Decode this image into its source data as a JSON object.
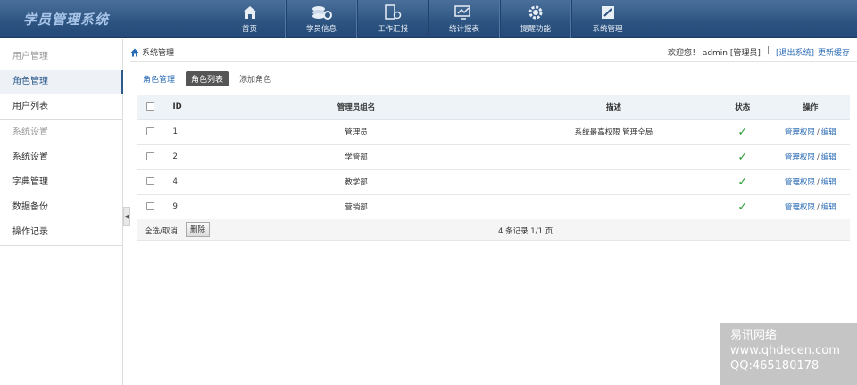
{
  "app": {
    "title": "学员管理系统"
  },
  "nav": [
    {
      "label": "首页",
      "icon": "home-icon"
    },
    {
      "label": "学员信息",
      "icon": "users-icon"
    },
    {
      "label": "工作汇报",
      "icon": "report-icon"
    },
    {
      "label": "统计报表",
      "icon": "chart-icon"
    },
    {
      "label": "提醒功能",
      "icon": "gear-icon"
    },
    {
      "label": "系统管理",
      "icon": "edit-icon"
    }
  ],
  "sidebar": {
    "group1": "用户管理",
    "items1": [
      "角色管理",
      "用户列表"
    ],
    "group2": "系统设置",
    "items2": [
      "系统设置",
      "字典管理",
      "数据备份",
      "操作记录"
    ]
  },
  "breadcrumb": {
    "label": "系统管理"
  },
  "user": {
    "greeting": "欢迎您！ admin [管理员]",
    "logout": "[退出系统]",
    "refresh": "更新缓存",
    "separator": "|"
  },
  "tabs": {
    "role_manage": "角色管理",
    "role_list": "角色列表",
    "add_role": "添加角色"
  },
  "table": {
    "headers": {
      "id": "ID",
      "name": "管理员组名",
      "desc": "描述",
      "status": "状态",
      "ops": "操作"
    },
    "rows": [
      {
        "id": "1",
        "name": "管理员",
        "desc": "系统最高权限 管理全局",
        "status": "✓"
      },
      {
        "id": "2",
        "name": "学管部",
        "desc": "",
        "status": "✓"
      },
      {
        "id": "4",
        "name": "教学部",
        "desc": "",
        "status": "✓"
      },
      {
        "id": "9",
        "name": "营销部",
        "desc": "",
        "status": "✓"
      }
    ],
    "op_perm": "管理权限",
    "op_sep": "/",
    "op_edit": "编辑"
  },
  "footer": {
    "select_all": "全选/取消",
    "delete": "删除",
    "pager": "4 条记录 1/1 页"
  },
  "watermark": {
    "line1": "易讯网络",
    "line2": "www.qhdecen.com",
    "line3": "QQ:465180178"
  },
  "colors": {
    "topbar": "#2d5480",
    "link": "#2a6bb5",
    "status_ok": "#2e9e36"
  }
}
